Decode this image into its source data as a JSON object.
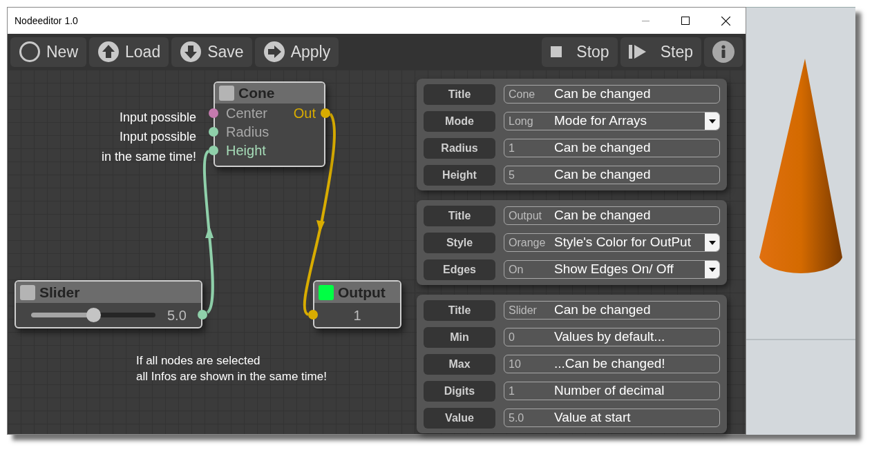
{
  "window": {
    "title": "Nodeeditor 1.0"
  },
  "toolbar": {
    "left": [
      {
        "kind": "new",
        "label": "New"
      },
      {
        "kind": "load",
        "label": "Load"
      },
      {
        "kind": "save",
        "label": "Save"
      },
      {
        "kind": "apply",
        "label": "Apply"
      }
    ],
    "right": [
      {
        "kind": "stop",
        "label": "Stop"
      },
      {
        "kind": "step",
        "label": "Step"
      },
      {
        "kind": "info"
      }
    ]
  },
  "notes": [
    {
      "kind": "port",
      "text": "Input possible"
    },
    {
      "kind": "port",
      "text": "Input possible"
    },
    {
      "kind": "port",
      "text": "in the same time!"
    },
    {
      "kind": "free",
      "text": "If all nodes are selected\nall Infos are shown in the same time!"
    }
  ],
  "nodes": {
    "cone": {
      "title": "Cone",
      "indicator_on": false,
      "inputs": [
        {
          "label": "Center",
          "color": "#c47aae",
          "connected": false
        },
        {
          "label": "Radius",
          "color": "#8fd0aa",
          "connected": false
        },
        {
          "label": "Height",
          "color": "#8fd0aa",
          "connected": true
        }
      ],
      "output": {
        "label": "Out",
        "color": "#d8ac00"
      }
    },
    "slider": {
      "title": "Slider",
      "indicator_on": false,
      "level": 0.5,
      "value": "5.0"
    },
    "output": {
      "title": "Output",
      "indicator_on": true,
      "value": "1"
    }
  },
  "panels": [
    {
      "rows": [
        {
          "label": "Title",
          "kind": "text",
          "value": "Cone",
          "hint": "Can be changed"
        },
        {
          "label": "Mode",
          "kind": "select",
          "value": "Long",
          "hint": "Mode for Arrays"
        },
        {
          "label": "Radius",
          "kind": "text",
          "value": "1",
          "hint": "Can be changed"
        },
        {
          "label": "Height",
          "kind": "text",
          "value": "5",
          "hint": "Can be changed"
        }
      ]
    },
    {
      "rows": [
        {
          "label": "Title",
          "kind": "text",
          "value": "Output",
          "hint": "Can be changed"
        },
        {
          "label": "Style",
          "kind": "select",
          "value": "Orange",
          "hint": "Style's Color for OutPut"
        },
        {
          "label": "Edges",
          "kind": "select",
          "value": "On",
          "hint": "Show Edges On/ Off"
        }
      ]
    },
    {
      "rows": [
        {
          "label": "Title",
          "kind": "text",
          "value": "Slider",
          "hint": "Can be changed"
        },
        {
          "label": "Min",
          "kind": "text",
          "value": "0",
          "hint": "Values by default..."
        },
        {
          "label": "Max",
          "kind": "text",
          "value": "10",
          "hint": "...Can be changed!"
        },
        {
          "label": "Digits",
          "kind": "text",
          "value": "1",
          "hint": "Number of decimal"
        },
        {
          "label": "Value",
          "kind": "text",
          "value": "5.0",
          "hint": "Value at start"
        }
      ]
    }
  ]
}
